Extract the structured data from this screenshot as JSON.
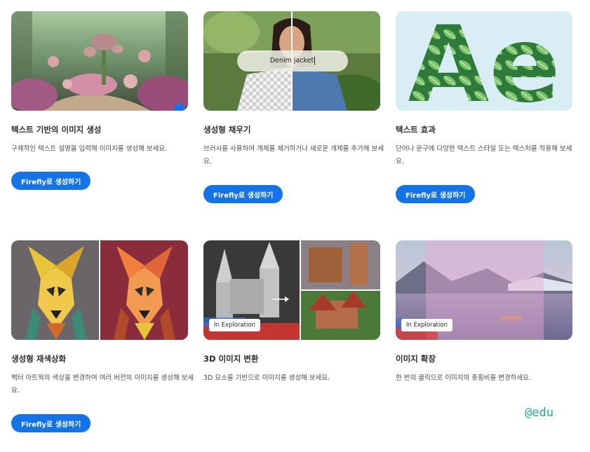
{
  "cards": [
    {
      "title": "텍스트 기반의 이미지 생성",
      "description": "구체적인 텍스트 설명을 입력해 이미지를 생성해 보세요.",
      "button": "Firefly로 생성하기",
      "image": "fantasy-garden-image"
    },
    {
      "title": "생성형 채우기",
      "description": "브러시를 사용하여 개체를 제거하거나 새로운 개체를 추가해 보세요.",
      "button": "Firefly로 생성하기",
      "image": "woman-denim-jacket-image",
      "prompt_text": "Denim jacket"
    },
    {
      "title": "텍스트 효과",
      "description": "단어나 문구에 다양한 텍스트 스타일 또는 텍스처를 적용해 보세요.",
      "button": "Firefly로 생성하기",
      "image": "leaf-letters-image",
      "art_text": "Ae"
    },
    {
      "title": "생성형 재색상화",
      "description": "벡터 아트웍의 색상을 변경하여 여러 버전의 이미지를 생성해 보세요.",
      "button": "Firefly로 생성하기",
      "image": "low-poly-dog-image"
    },
    {
      "title": "3D 이미지 변환",
      "description": "3D 요소를 기반으로 이미지를 생성해 보세요.",
      "image": "3d-castle-image",
      "badge": "In Exploration"
    },
    {
      "title": "이미지 확장",
      "description": "한 번의 클릭으로 이미지의 종횡비를 변경하세요.",
      "image": "lake-landscape-image",
      "badge": "In Exploration"
    }
  ],
  "watermark": "@edu",
  "colors": {
    "button": "#1473e6",
    "watermark": "#1fa89a"
  }
}
